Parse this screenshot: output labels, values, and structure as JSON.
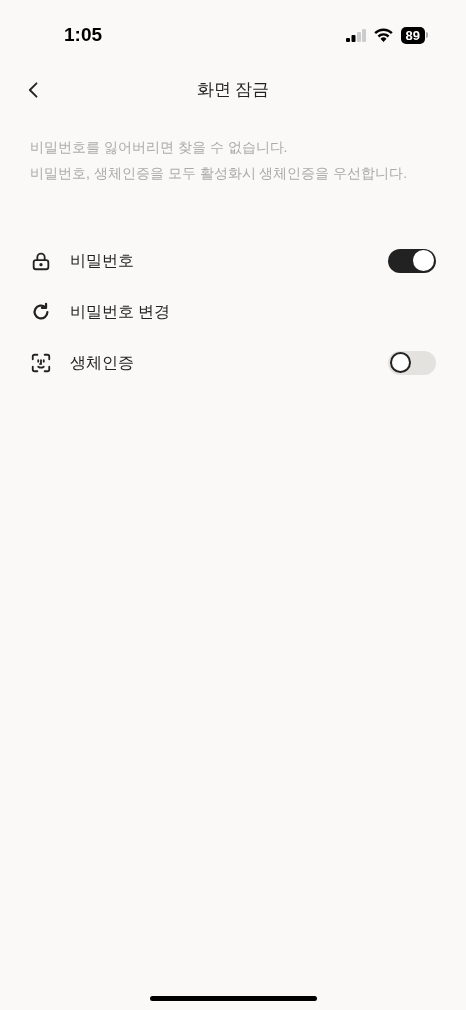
{
  "status_bar": {
    "time": "1:05",
    "battery": "89"
  },
  "header": {
    "title": "화면 잠금"
  },
  "description": [
    "비밀번호를 잃어버리면 찾을 수 없습니다.",
    "비밀번호, 생체인증을 모두 활성화시 생체인증을 우선합니다."
  ],
  "items": [
    {
      "kind": "toggle",
      "label": "비밀번호",
      "on": true
    },
    {
      "kind": "link",
      "label": "비밀번호 변경"
    },
    {
      "kind": "toggle",
      "label": "생체인증",
      "on": false
    }
  ]
}
